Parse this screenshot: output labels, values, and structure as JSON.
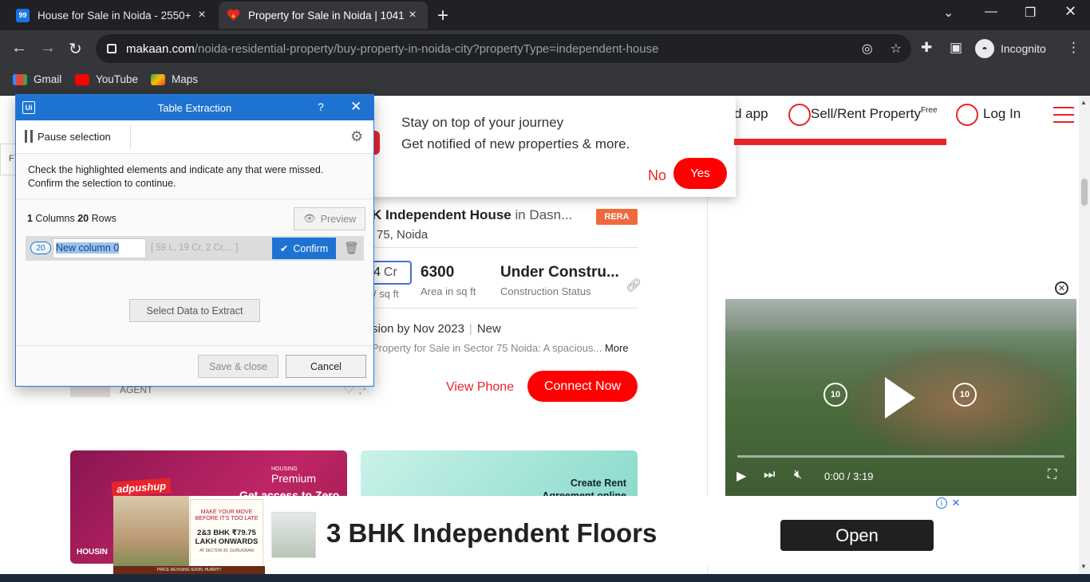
{
  "browser": {
    "tabs": [
      {
        "title": "House for Sale in Noida - 2550+",
        "favicon": "99acres-icon",
        "active": false
      },
      {
        "title": "Property for Sale in Noida | 1041",
        "favicon": "makaan-heart-icon",
        "active": true
      }
    ],
    "url_host": "makaan.com",
    "url_path": "/noida-residential-property/buy-property-in-noida-city?propertyType=independent-house",
    "incognito_label": "Incognito",
    "bookmarks": [
      "Gmail",
      "YouTube",
      "Maps"
    ]
  },
  "site_header": {
    "download_app_fragment": "d app",
    "sell_rent": "Sell/Rent Property",
    "sell_rent_sup": "Free",
    "login": "Log In"
  },
  "notification": {
    "line1": "Stay on top of your journey",
    "line2": "Get notified of new properties & more.",
    "no": "No",
    "yes": "Yes"
  },
  "listing": {
    "title_bold": "K Independent House",
    "title_rest": " in Dasn...",
    "rera": "RERA",
    "location": "75, Noida",
    "price_fragment": "4",
    "price_unit": "Cr",
    "per_sqft": "/ sq ft",
    "area_value": "6300",
    "area_label": "Area in sq ft",
    "status_value": "Under Constru...",
    "status_label": "Construction Status",
    "possession": "sion by Nov 2023",
    "condition": "New",
    "description": "Property for Sale in Sector 75 Noida: A spacious...",
    "more": "More",
    "view_phone": "View Phone",
    "connect_now": "Connect Now",
    "agent_label": "AGENT"
  },
  "promos": {
    "adpushup": "adpushup",
    "premium_small": "HOUSING",
    "premium": "Premium",
    "premium_text": "Get access to Zero",
    "housing": "HOUSIN",
    "rent_text": "Create Rent Agreement online"
  },
  "video": {
    "skip_back": "10",
    "skip_fwd": "10",
    "time_current": "0:00",
    "time_total": "3:19"
  },
  "bottom_ad": {
    "card_line1": "MAKE YOUR MOVE BEFORE IT'S TOO LATE",
    "card_line2": "2&3 BHK ₹79.75 LAKH ONWARDS",
    "card_line3": "AT SECTOR 35, GURUGRAM",
    "footer_strip": "PRICE REVISING SOON. HURRY!!",
    "headline": "3 BHK Independent Floors",
    "open": "Open"
  },
  "dialog": {
    "title": "Table Extraction",
    "help": "?",
    "pause": "Pause selection",
    "instructions_1": "Check the highlighted elements and indicate any that were missed.",
    "instructions_2": "Confirm the selection to continue.",
    "columns_count": "1",
    "columns_label": " Columns ",
    "rows_count": "20",
    "rows_label": " Rows",
    "preview": "Preview",
    "column_badge": "20",
    "column_name": "New column 0",
    "column_sample": "[ 59 L,  19 Cr,  2 Cr,... ]",
    "confirm": "Confirm",
    "select_data": "Select Data to Extract",
    "save_close": "Save & close",
    "cancel": "Cancel"
  },
  "colors": {
    "accent_red": "#e9232a",
    "dialog_blue": "#1e73d2"
  }
}
